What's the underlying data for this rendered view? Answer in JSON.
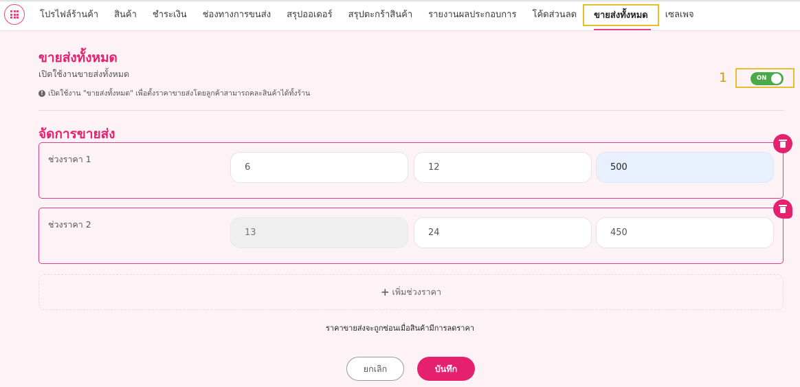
{
  "nav": {
    "items": [
      "โปรไฟล์ร้านค้า",
      "สินค้า",
      "ชำระเงิน",
      "ช่องทางการขนส่ง",
      "สรุปออเดอร์",
      "สรุปตะกร้าสินค้า",
      "รายงานผลประกอบการ",
      "โค้ดส่วนลด",
      "ขายส่งทั้งหมด",
      "เซลเพจ"
    ],
    "active_index": 8
  },
  "header": {
    "title": "ขายส่งทั้งหมด",
    "subtitle": "เปิดใช้งานขายส่งทั้งหมด",
    "note": "เปิดใช้งาน \"ขายส่งทั้งหมด\" เพื่อตั้งราคาขายส่งโดยลูกค้าสามารถคละสินค้าได้ทั้งร้าน"
  },
  "toggle": {
    "label": "ON",
    "state": "on",
    "annotation": "1"
  },
  "manage": {
    "title": "จัดการขายส่ง",
    "tiers": [
      {
        "label": "ช่วงราคา 1",
        "min": "6",
        "max": "12",
        "price": "500"
      },
      {
        "label": "ช่วงราคา 2",
        "min": "13",
        "max": "24",
        "price": "450"
      }
    ],
    "add_label": "เพิ่มช่วงราคา"
  },
  "hint": "ราคาขายส่งจะถูกซ่อนเมื่อสินค้ามีการลดราคา",
  "buttons": {
    "cancel": "ยกเลิก",
    "save": "บันทึก"
  },
  "colors": {
    "accent": "#e5206f",
    "toggle_on": "#4aaa4a",
    "annotation": "#e8bd2c"
  }
}
